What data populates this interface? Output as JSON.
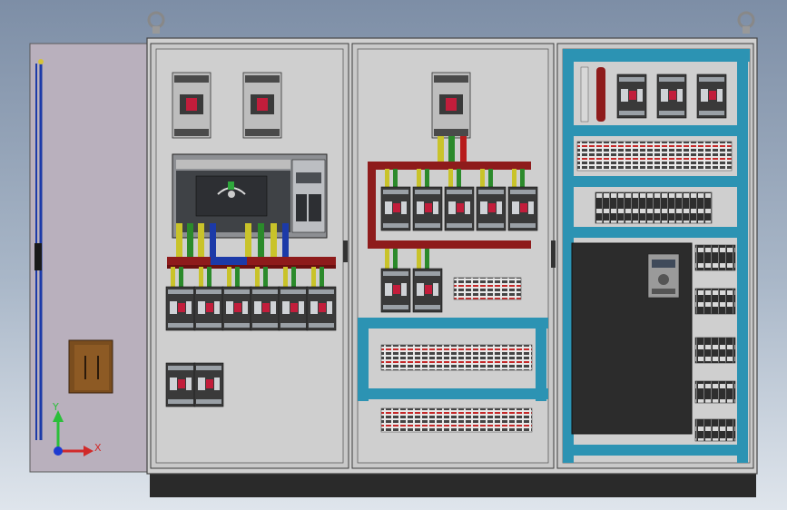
{
  "scene": {
    "background_top": "#7d8ea6",
    "background_bottom": "#dfe5ec",
    "cabinet_color": "#c4c4c4",
    "door_color": "#b9b0bd",
    "busbar_red": "#8e1b1b",
    "cable_blue": "#1c3aa8",
    "cable_yellow": "#c9c32a",
    "cable_green": "#2b8a2b",
    "channel_teal": "#2c93b3"
  },
  "axes": {
    "x_label": "X",
    "y_label": "Y"
  }
}
